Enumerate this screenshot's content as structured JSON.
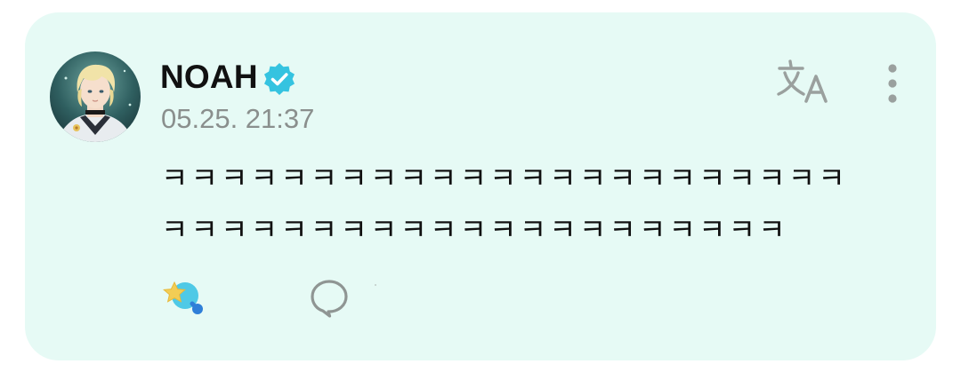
{
  "post": {
    "author": {
      "name": "NOAH",
      "verified": true,
      "avatar_icon": "avatar-illustration"
    },
    "timestamp": "05.25. 21:37",
    "message": "ㅋㅋㅋㅋㅋㅋㅋㅋㅋㅋㅋㅋㅋㅋㅋㅋㅋㅋㅋㅋㅋㅋㅋㅋㅋㅋㅋㅋㅋㅋㅋㅋㅋㅋㅋㅋㅋㅋㅋㅋㅋㅋㅋㅋ",
    "actions": {
      "translate_icon": "translate-icon",
      "more_icon": "more-vertical-icon",
      "reaction_icon": "star-bubble-icon",
      "comment_icon": "comment-bubble-icon"
    }
  },
  "colors": {
    "card_background": "#e6faf5",
    "verified_badge": "#35c3e0",
    "text_primary": "#111111",
    "text_secondary": "#8a8f8d",
    "icon_gray": "#9aa09e"
  }
}
